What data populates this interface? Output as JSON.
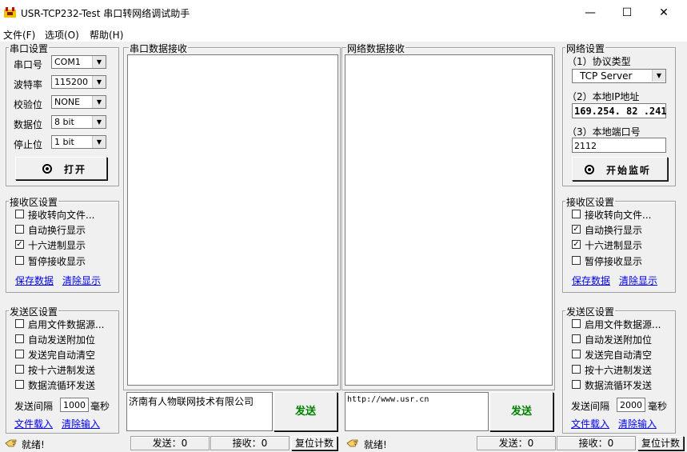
{
  "window": {
    "title": "USR-TCP232-Test 串口转网络调试助手",
    "minimize_glyph": "—",
    "maximize_glyph": "☐",
    "close_glyph": "✕"
  },
  "menu": [
    "文件(F)",
    "选项(O)",
    "帮助(H)"
  ],
  "serial_settings": {
    "title": "串口设置",
    "port_label": "串口号",
    "port_value": "COM1",
    "baud_label": "波特率",
    "baud_value": "115200",
    "parity_label": "校验位",
    "parity_value": "NONE",
    "databits_label": "数据位",
    "databits_value": "8 bit",
    "stopbits_label": "停止位",
    "stopbits_value": "1 bit",
    "open_button": "打开"
  },
  "serial_receive_settings": {
    "title": "接收区设置",
    "options": [
      {
        "label": "接收转向文件...",
        "checked": false
      },
      {
        "label": "自动换行显示",
        "checked": false
      },
      {
        "label": "十六进制显示",
        "checked": true
      },
      {
        "label": "暂停接收显示",
        "checked": false
      }
    ],
    "save_link": "保存数据",
    "clear_link": "清除显示"
  },
  "serial_send_settings": {
    "title": "发送区设置",
    "options": [
      {
        "label": "启用文件数据源...",
        "checked": false
      },
      {
        "label": "自动发送附加位",
        "checked": false
      },
      {
        "label": "发送完自动清空",
        "checked": false
      },
      {
        "label": "按十六进制发送",
        "checked": false
      },
      {
        "label": "数据流循环发送",
        "checked": false
      }
    ],
    "interval_label": "发送间隔",
    "interval_value": "1000",
    "interval_unit": "毫秒",
    "load_file_link": "文件载入",
    "clear_input_link": "清除输入"
  },
  "serial_receive_panel": {
    "title": "串口数据接收"
  },
  "network_receive_panel": {
    "title": "网络数据接收"
  },
  "serial_send": {
    "text": "济南有人物联网技术有限公司",
    "button": "发送"
  },
  "network_send": {
    "text": "http://www.usr.cn",
    "button": "发送"
  },
  "network_settings": {
    "title": "网络设置",
    "protocol_label": "（1）协议类型",
    "protocol_value": "TCP Server",
    "ip_label": "（2）本地IP地址",
    "ip_value": "169.254. 82 .241",
    "port_label": "（3）本地端口号",
    "port_value": "2112",
    "listen_button": "开始监听"
  },
  "network_receive_settings": {
    "title": "接收区设置",
    "options": [
      {
        "label": "接收转向文件...",
        "checked": false
      },
      {
        "label": "自动换行显示",
        "checked": true
      },
      {
        "label": "十六进制显示",
        "checked": true
      },
      {
        "label": "暂停接收显示",
        "checked": false
      }
    ],
    "save_link": "保存数据",
    "clear_link": "清除显示"
  },
  "network_send_settings": {
    "title": "发送区设置",
    "options": [
      {
        "label": "启用文件数据源...",
        "checked": false
      },
      {
        "label": "自动发送附加位",
        "checked": false
      },
      {
        "label": "发送完自动清空",
        "checked": false
      },
      {
        "label": "按十六进制发送",
        "checked": false
      },
      {
        "label": "数据流循环发送",
        "checked": false
      }
    ],
    "interval_label": "发送间隔",
    "interval_value": "2000",
    "interval_unit": "毫秒",
    "load_file_link": "文件载入",
    "clear_input_link": "清除输入"
  },
  "status_left": {
    "status": "就绪!",
    "send": "发送：0",
    "receive": "接收：0",
    "reset": "复位计数"
  },
  "status_right": {
    "status": "就绪!",
    "send": "发送：0",
    "receive": "接收：0",
    "reset": "复位计数"
  }
}
